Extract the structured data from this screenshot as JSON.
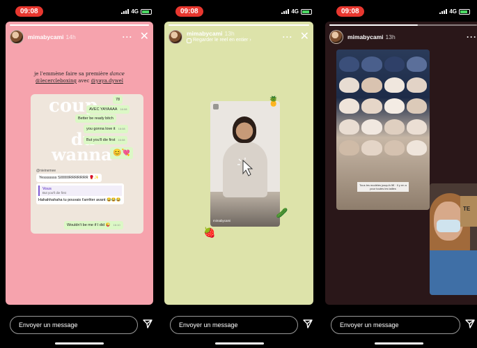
{
  "status_bar": {
    "time": "09:08",
    "network": "4G"
  },
  "panels": [
    {
      "username": "mimabycami",
      "time_ago": "14h",
      "caption_line1": "je l'emmène faire sa première ",
      "caption_script": "dance",
      "caption_line2_a": "@lecercleboxing",
      "caption_line2_b": " avec ",
      "caption_line2_c": "@yaya.dywel",
      "big_text_1": "coup",
      "big_text_2": "du",
      "big_text_3": "wanna",
      "chat": {
        "top_time": "78",
        "msg1": "AVEC YAYAAAA",
        "msg2": "Better be ready bitch",
        "msg3": "you gonna love it",
        "msg4": "But you'll die first",
        "msg5": "😊💘",
        "tag": "@nieinemee",
        "msg6": "Yesssssss SIIIIIIIIRRRRRRR 🥊✨",
        "quote_author": "Vous",
        "quote_text": "But you'll die first",
        "msg7": "Hahahhahaha tu pouvais t'arrêter avant 😂😂😂",
        "msg8": "Wouldn't be me if I did 😜",
        "time1": "16:08",
        "time2": "16:10"
      }
    },
    {
      "username": "mimabycami",
      "time_ago": "13h",
      "subline": "Regarder le reel en entier ›",
      "reel_name": "mimabycami"
    },
    {
      "username": "mimabycami",
      "time_ago": "13h",
      "photo_label": "Tous les modèles jusqu'à 5€ · Il y en a pour toutes les tailles",
      "bag_text": "TE"
    }
  ],
  "composer": {
    "placeholder": "Envoyer un message"
  },
  "colors": {
    "panel1_bg": "#f6a3ad",
    "panel2_bg": "#dde3aa",
    "panel3_bg": "#2a1719",
    "time_pill": "#e8372f"
  }
}
